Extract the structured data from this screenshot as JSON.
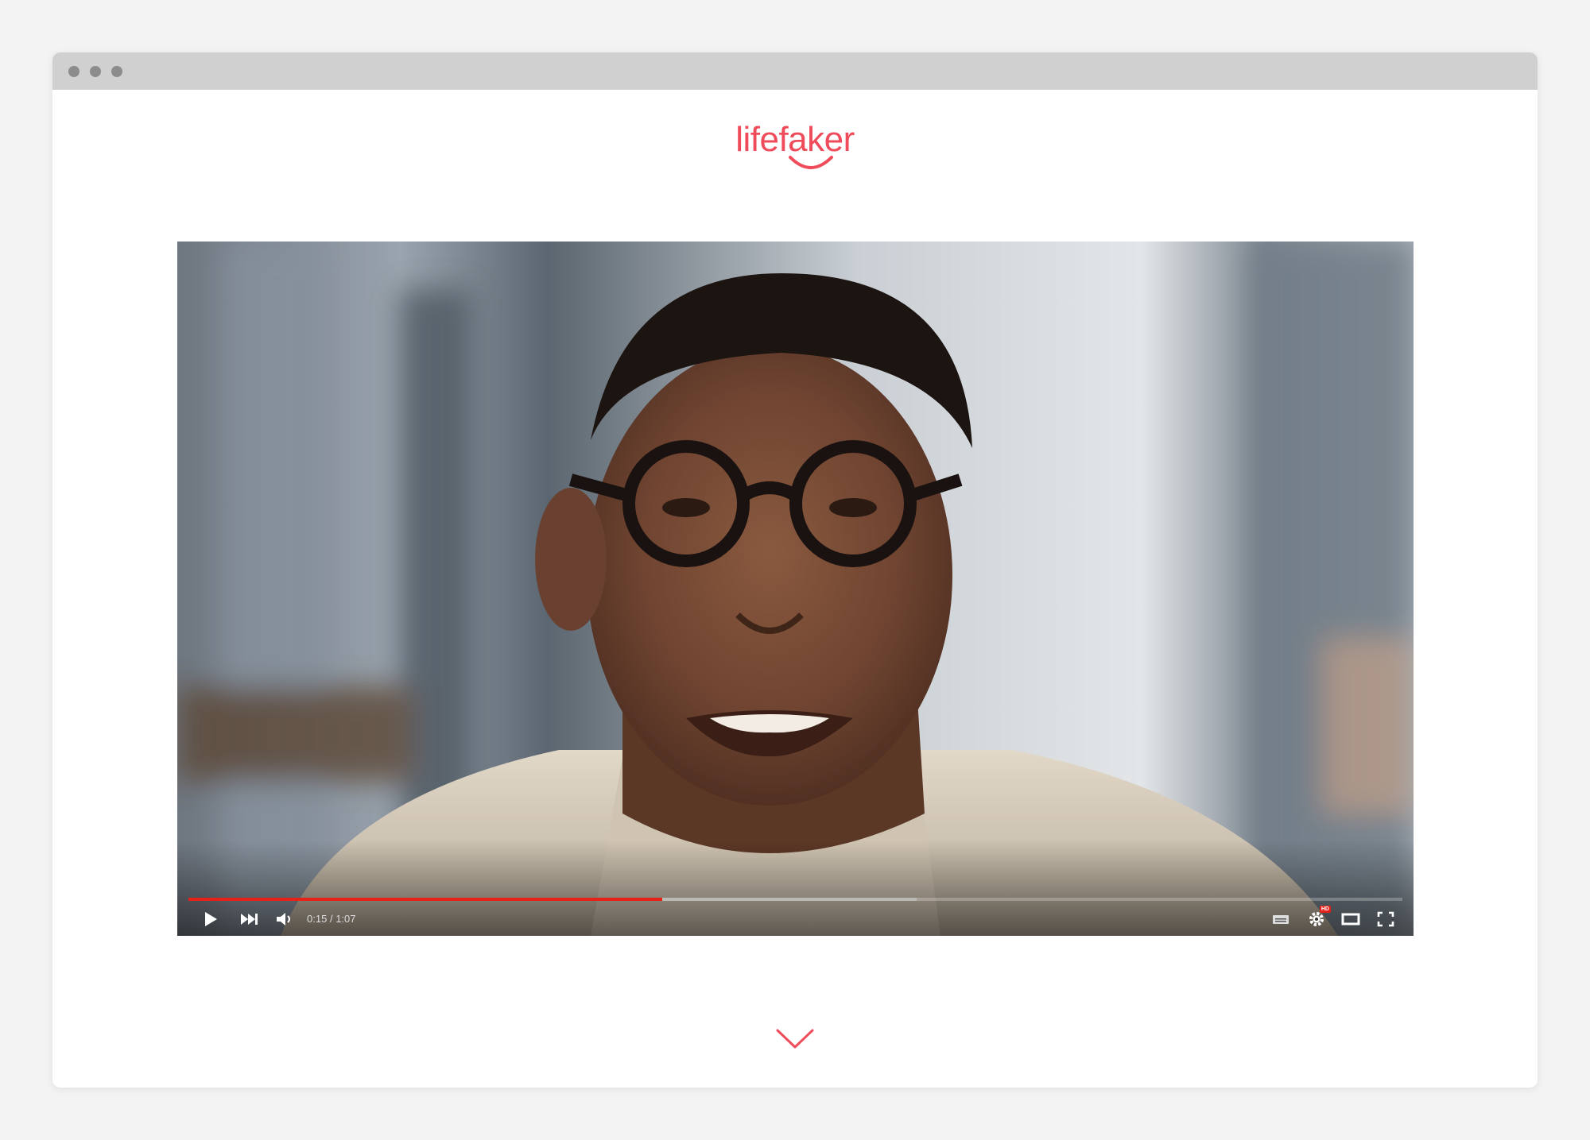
{
  "colors": {
    "brand": "#ef4b5a",
    "accent": "#e62117"
  },
  "header": {
    "logo_text": "lifefaker"
  },
  "video": {
    "current_time": "0:15",
    "separator": "/",
    "duration": "1:07",
    "played_fraction": 0.39,
    "buffered_fraction": 0.6,
    "hd_badge": "HD",
    "controls": {
      "play_icon": "play-icon",
      "next_icon": "next-icon",
      "volume_icon": "volume-icon",
      "subtitles_icon": "subtitles-icon",
      "settings_icon": "gear-icon",
      "theater_icon": "theater-mode-icon",
      "fullscreen_icon": "fullscreen-icon"
    }
  },
  "scroll_indicator_icon": "chevron-down-icon"
}
